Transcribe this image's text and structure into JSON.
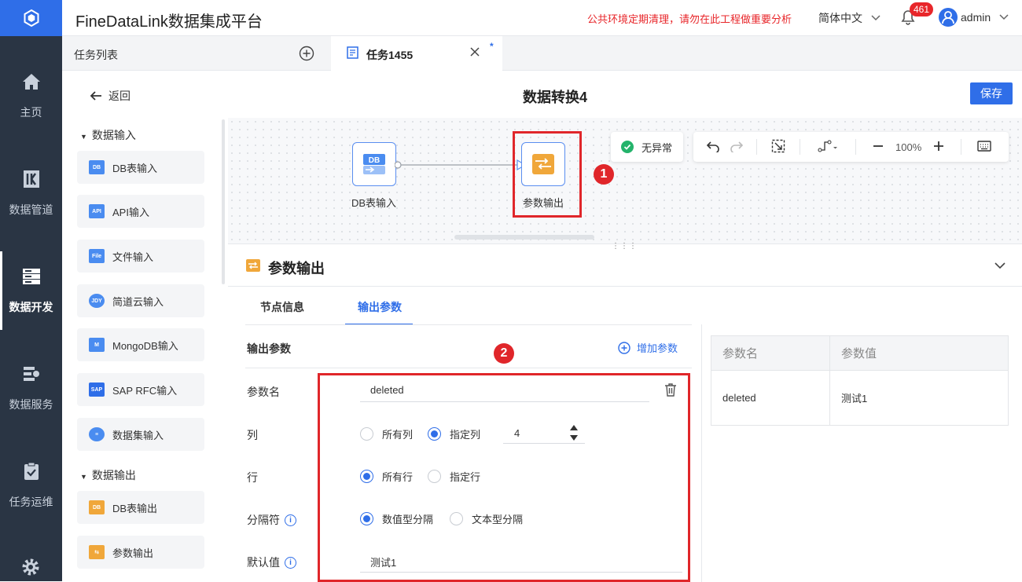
{
  "app": {
    "title": "FineDataLink数据集成平台",
    "notice": "公共环境定期清理，请勿在此工程做重要分析",
    "language": "简体中文",
    "notification_count": "461",
    "user": "admin"
  },
  "nav": {
    "items": [
      {
        "label": "主页",
        "icon": "home-icon"
      },
      {
        "label": "数据管道",
        "icon": "pipeline-icon"
      },
      {
        "label": "数据开发",
        "icon": "dev-icon",
        "active": true
      },
      {
        "label": "数据服务",
        "icon": "service-icon"
      },
      {
        "label": "任务运维",
        "icon": "clipboard-icon"
      }
    ]
  },
  "tabs": {
    "list_label": "任务列表",
    "task_label": "任务1455",
    "modified_mark": "*"
  },
  "subheader": {
    "back_label": "返回",
    "title": "数据转换4",
    "save_label": "保存"
  },
  "components": {
    "input_category": "数据输入",
    "inputs": [
      "DB表输入",
      "API输入",
      "文件输入",
      "简道云输入",
      "MongoDB输入",
      "SAP RFC输入",
      "数据集输入"
    ],
    "output_category": "数据输出",
    "outputs": [
      "DB表输出",
      "参数输出"
    ]
  },
  "canvas": {
    "nodes": [
      {
        "label": "DB表输入",
        "icon_text": "DB"
      },
      {
        "label": "参数输出"
      }
    ],
    "status": "无异常",
    "zoom": "100%",
    "markers": [
      "1",
      "2"
    ]
  },
  "detail": {
    "title": "参数输出",
    "tabs": [
      "节点信息",
      "输出参数"
    ],
    "active_tab": "输出参数",
    "section_label": "输出参数",
    "add_param_label": "增加参数",
    "fields": {
      "param_name": {
        "label": "参数名",
        "value": "deleted"
      },
      "column": {
        "label": "列",
        "options": [
          "所有列",
          "指定列"
        ],
        "selected": "指定列",
        "value": "4"
      },
      "row": {
        "label": "行",
        "options": [
          "所有行",
          "指定行"
        ],
        "selected": "所有行"
      },
      "separator": {
        "label": "分隔符",
        "options": [
          "数值型分隔",
          "文本型分隔"
        ],
        "selected": "数值型分隔"
      },
      "default": {
        "label": "默认值",
        "value": "测试1"
      }
    },
    "preview": {
      "headers": [
        "参数名",
        "参数值"
      ],
      "rows": [
        [
          "deleted",
          "测试1"
        ]
      ]
    }
  },
  "colors": {
    "accent": "#2f6ee8",
    "nav_bg": "#2a3544",
    "highlight": "#e0262a"
  }
}
